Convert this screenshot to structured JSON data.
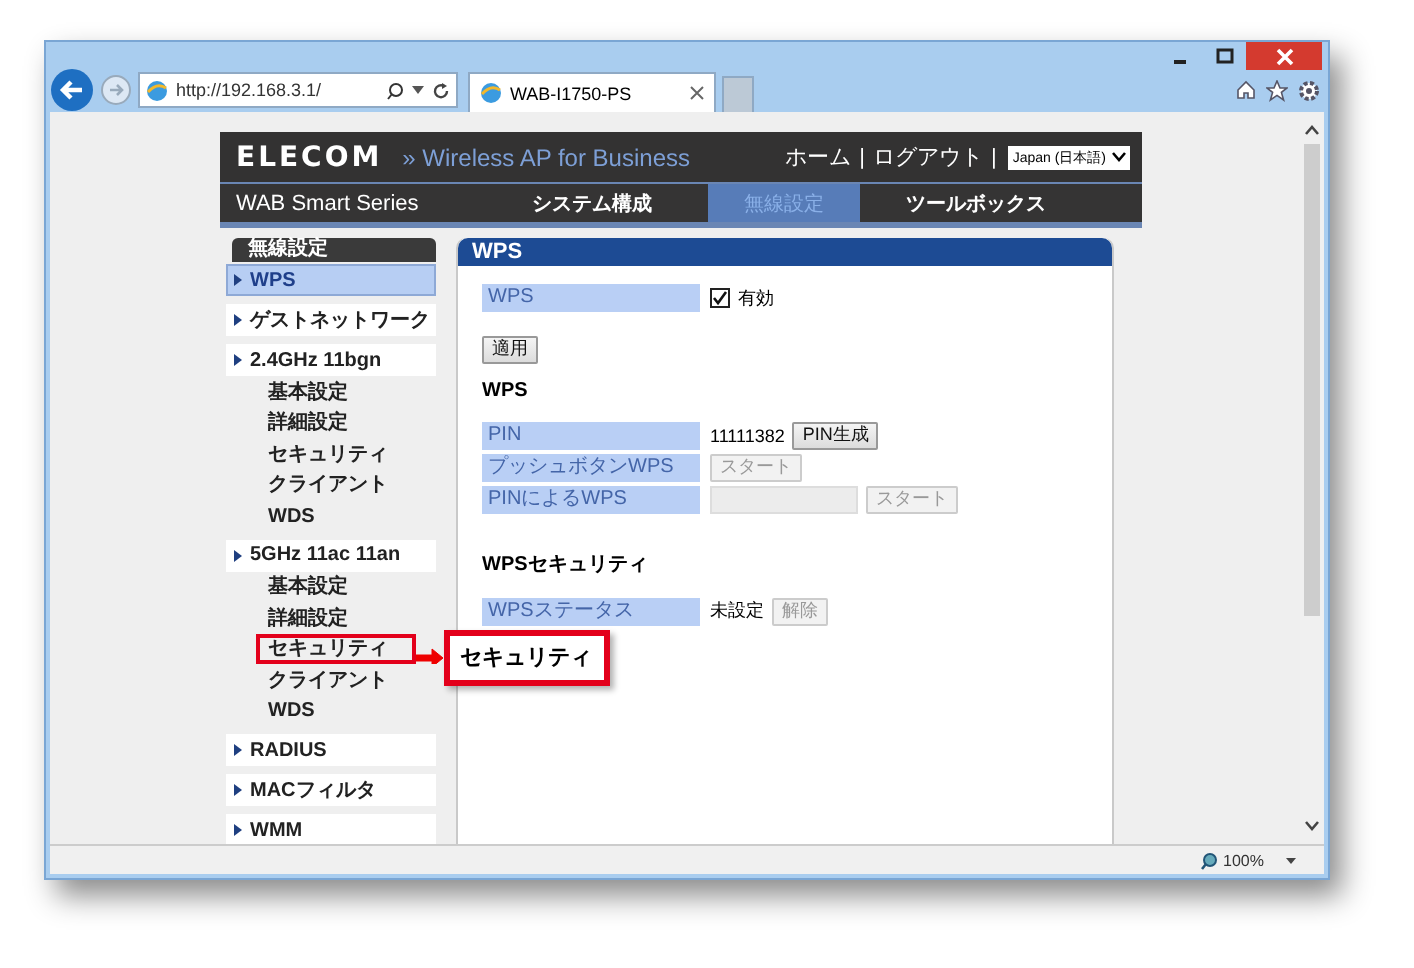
{
  "browser": {
    "address": "http://192.168.3.1/",
    "tab_title": "WAB-I1750-PS",
    "zoom": "100%"
  },
  "header": {
    "logo": "ELECOM",
    "tagline": "» Wireless AP for Business",
    "links": [
      {
        "label": "ホーム",
        "separator": "|"
      },
      {
        "label": "ログアウト",
        "separator": "|"
      }
    ],
    "language": "Japan (日本語)"
  },
  "nav": {
    "series": "WAB Smart Series",
    "tabs": [
      {
        "label": "システム構成",
        "selected": false
      },
      {
        "label": "無線設定",
        "selected": true
      },
      {
        "label": "ツールボックス",
        "selected": false
      }
    ]
  },
  "sidebar": {
    "heading": "無線設定",
    "items": [
      {
        "label": "WPS",
        "selected": true
      },
      {
        "label": "ゲストネットワーク",
        "selected": false
      },
      {
        "label": "2.4GHz 11bgn",
        "selected": false,
        "children": [
          {
            "label": "基本設定",
            "highlighted": false
          },
          {
            "label": "詳細設定",
            "highlighted": false
          },
          {
            "label": "セキュリティ",
            "highlighted": false
          },
          {
            "label": "クライアント",
            "highlighted": false
          },
          {
            "label": "WDS",
            "highlighted": false
          }
        ]
      },
      {
        "label": "5GHz 11ac 11an",
        "selected": false,
        "children": [
          {
            "label": "基本設定",
            "highlighted": false
          },
          {
            "label": "詳細設定",
            "highlighted": false
          },
          {
            "label": "セキュリティ",
            "highlighted": true
          },
          {
            "label": "クライアント",
            "highlighted": false
          },
          {
            "label": "WDS",
            "highlighted": false
          }
        ]
      },
      {
        "label": "RADIUS",
        "selected": false
      },
      {
        "label": "MACフィルタ",
        "selected": false
      },
      {
        "label": "WMM",
        "selected": false
      }
    ]
  },
  "callout": {
    "text": "セキュリティ"
  },
  "main": {
    "title": "WPS",
    "enable": {
      "label": "WPS",
      "checked": true,
      "text": "有効"
    },
    "apply_button": "適用",
    "sections": [
      {
        "heading": "WPS",
        "rows": [
          {
            "label": "PIN",
            "value": "11111382",
            "input": false,
            "button": {
              "label": "PIN生成",
              "disabled": false
            }
          },
          {
            "label": "プッシュボタンWPS",
            "input": false,
            "button": {
              "label": "スタート",
              "disabled": true
            }
          },
          {
            "label": "PINによるWPS",
            "input": true,
            "button": {
              "label": "スタート",
              "disabled": true
            }
          }
        ]
      },
      {
        "heading": "WPSセキュリティ",
        "rows": [
          {
            "label": "WPSステータス",
            "value": "未設定",
            "input": false,
            "button": {
              "label": "解除",
              "disabled": true
            }
          }
        ]
      }
    ]
  }
}
